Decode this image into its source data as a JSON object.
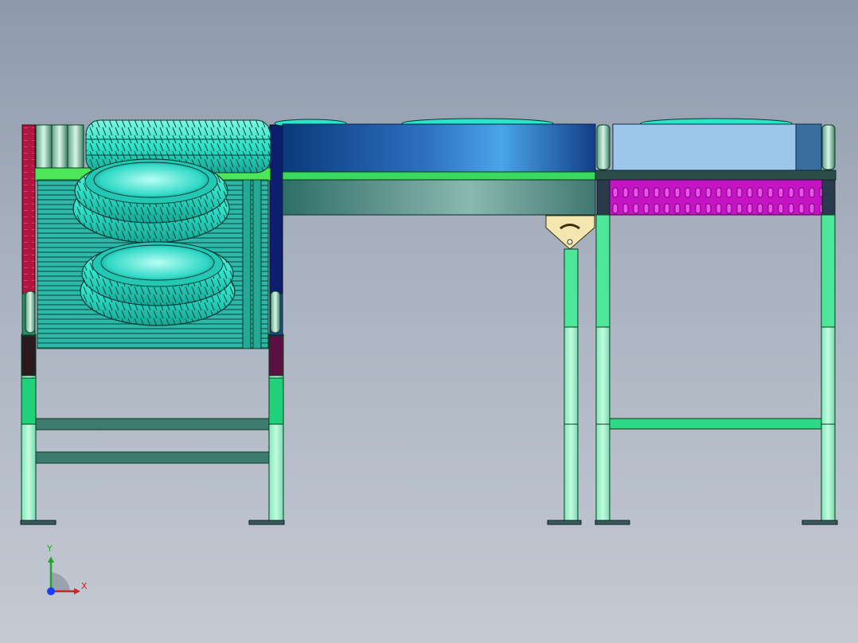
{
  "viewport": {
    "background_top": "#8e9aab",
    "background_bottom": "#c4cad3"
  },
  "colors": {
    "frame_dark": "#0a3c1e",
    "leg_light": "#9ef5c8",
    "leg_green": "#1fd27a",
    "leg_mid": "#4ee69b",
    "belt_blue_dark": "#0a3a7a",
    "belt_blue_light": "#4aa4e8",
    "belt_panel_light": "#9cc6ea",
    "roller_magenta": "#c414c4",
    "side_red": "#b21640",
    "side_navy": "#0c1e6e",
    "tire_cyan": "#28e6c8",
    "rollers_teal": "#38c0b0",
    "bracket_yellow": "#f4e6b0"
  },
  "triad": {
    "x_label": "X",
    "y_label": "Y",
    "x_color": "#d42020",
    "y_color": "#1fa52a",
    "z_color": "#1a3cff"
  }
}
